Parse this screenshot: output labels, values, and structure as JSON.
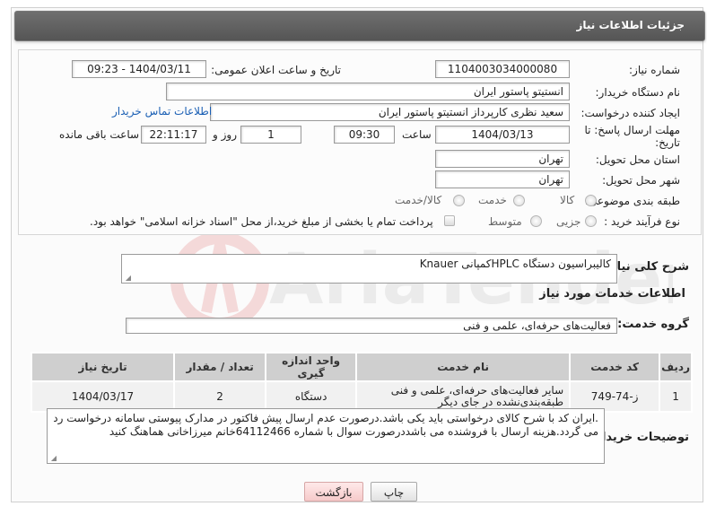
{
  "header": {
    "title": "جزئیات اطلاعات نیاز"
  },
  "form": {
    "need_number_label": "شماره نیاز:",
    "need_number": "1104003034000080",
    "announce_datetime_label": "تاریخ و ساعت اعلان عمومی:",
    "announce_datetime": "1404/03/11 - 09:23",
    "buyer_org_label": "نام دستگاه خریدار:",
    "buyer_org": "انستیتو پاستور ایران",
    "creator_label": "ایجاد کننده درخواست:",
    "creator": "سعید نظری کارپرداز انستیتو پاستور ایران",
    "contact_link": "اطلاعات تماس خریدار",
    "deadline_label_1": "مهلت ارسال پاسخ: تا",
    "deadline_label_2": "تاریخ:",
    "deadline_date": "1404/03/13",
    "time_label": "ساعت",
    "deadline_time": "09:30",
    "days_value": "1",
    "days_label": "روز و",
    "remaining_time": "22:11:17",
    "remaining_label": "ساعت باقی مانده",
    "province_label": "استان محل تحویل:",
    "province": "تهران",
    "city_label": "شهر محل تحویل:",
    "city": "تهران",
    "category_label": "طبقه بندی موضوعی:",
    "category_options": [
      "کالا",
      "خدمت",
      "کالا/خدمت"
    ],
    "process_label": "نوع فرآیند خرید :",
    "process_options": [
      "جزیی",
      "متوسط"
    ],
    "payment_note": "پرداخت تمام یا بخشی از مبلغ خرید،از محل \"اسناد خزانه اسلامی\" خواهد بود."
  },
  "summary": {
    "label": "شرح کلی نیاز:",
    "text": "کالیبراسیون دستگاه HPLCکمپانی Knauer"
  },
  "services": {
    "title": "اطلاعات خدمات مورد نیاز",
    "group_label": "گروه خدمت:",
    "group_value": "فعالیت‌های حرفه‌ای، علمی و فنی"
  },
  "table": {
    "headers": [
      "ردیف",
      "کد خدمت",
      "نام خدمت",
      "واحد اندازه گیری",
      "تعداد / مقدار",
      "تاریخ نیاز"
    ],
    "rows": [
      [
        "1",
        "ز-74-749",
        "سایر فعالیت‌های حرفه‌ای، علمی و فنی طبقه‌بندی‌نشده در جای دیگر",
        "دستگاه",
        "2",
        "1404/03/17"
      ]
    ]
  },
  "buyer_notes": {
    "label": "توضیحات خریدار:",
    "text": ".ایران کد با شرح کالای درخواستی باید یکی باشد.درصورت عدم ارسال پیش فاکتور در مدارک پیوستی سامانه درخواست رد می گردد.هزینه ارسال با فروشنده می باشددرصورت سوال با شماره 64112466خانم میرزاخانی هماهنگ کنید"
  },
  "buttons": {
    "print": "چاپ",
    "back": "بازگشت"
  },
  "colors": {
    "header_bg": "#606060",
    "link": "#1a5fb4",
    "table_header": "#cfcfcf"
  },
  "watermark": {
    "text": "AriaTender.neT"
  }
}
